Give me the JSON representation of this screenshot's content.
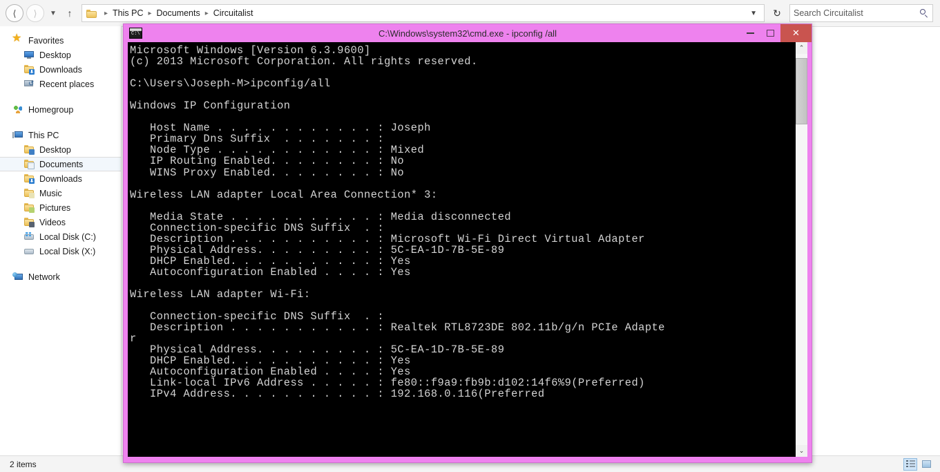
{
  "explorer": {
    "nav": {
      "back_icon": "arrow-left-icon",
      "forward_icon": "arrow-right-icon",
      "history_icon": "chevron-down-icon",
      "up_icon": "arrow-up-icon"
    },
    "breadcrumb": {
      "folder_icon": "folder-icon",
      "items": [
        "This PC",
        "Documents",
        "Circuitalist"
      ],
      "separator": "▸",
      "dropdown_icon": "chevron-down-icon",
      "refresh_icon": "refresh-icon",
      "refresh_glyph": "↻"
    },
    "search": {
      "placeholder": "Search Circuitalist",
      "value": "",
      "icon": "search-icon"
    },
    "sidebar": {
      "groups": [
        {
          "header": {
            "label": "Favorites",
            "icon": "star-icon"
          },
          "items": [
            {
              "label": "Desktop",
              "icon": "monitor-icon"
            },
            {
              "label": "Downloads",
              "icon": "folder-download-icon"
            },
            {
              "label": "Recent places",
              "icon": "recent-places-icon"
            }
          ]
        },
        {
          "header": {
            "label": "Homegroup",
            "icon": "homegroup-icon"
          },
          "items": []
        },
        {
          "header": {
            "label": "This PC",
            "icon": "computer-icon"
          },
          "items": [
            {
              "label": "Desktop",
              "icon": "folder-desktop-icon"
            },
            {
              "label": "Documents",
              "icon": "folder-documents-icon",
              "selected": true
            },
            {
              "label": "Downloads",
              "icon": "folder-download-icon"
            },
            {
              "label": "Music",
              "icon": "folder-music-icon"
            },
            {
              "label": "Pictures",
              "icon": "folder-pictures-icon"
            },
            {
              "label": "Videos",
              "icon": "folder-videos-icon"
            },
            {
              "label": "Local Disk (C:)",
              "icon": "hard-disk-windows-icon"
            },
            {
              "label": "Local Disk (X:)",
              "icon": "hard-disk-icon"
            }
          ]
        },
        {
          "header": {
            "label": "Network",
            "icon": "network-icon"
          },
          "items": []
        }
      ]
    },
    "status": {
      "item_count": "2 items",
      "details_view_icon": "details-view-icon",
      "tiles_view_icon": "large-icons-view-icon"
    }
  },
  "cmd_window": {
    "title": "C:\\Windows\\system32\\cmd.exe - ipconfig /all",
    "app_icon": "console-icon",
    "border_color": "#ee82ee",
    "background_color": "#000000",
    "text_color": "#d4d4d4",
    "controls": {
      "minimize": "minimize-button",
      "maximize": "maximize-button",
      "close": "close-button",
      "close_glyph": "✕",
      "close_color": "#c9544f"
    },
    "scrollbar": {
      "up_glyph": "⌃",
      "down_glyph": "⌄",
      "thumb_top_pct": 1,
      "thumb_height_pct": 17
    },
    "console_lines": [
      "Microsoft Windows [Version 6.3.9600]",
      "(c) 2013 Microsoft Corporation. All rights reserved.",
      "",
      "C:\\Users\\Joseph-M>ipconfig/all",
      "",
      "Windows IP Configuration",
      "",
      "   Host Name . . . . . . . . . . . . : Joseph",
      "   Primary Dns Suffix  . . . . . . . :",
      "   Node Type . . . . . . . . . . . . : Mixed",
      "   IP Routing Enabled. . . . . . . . : No",
      "   WINS Proxy Enabled. . . . . . . . : No",
      "",
      "Wireless LAN adapter Local Area Connection* 3:",
      "",
      "   Media State . . . . . . . . . . . : Media disconnected",
      "   Connection-specific DNS Suffix  . :",
      "   Description . . . . . . . . . . . : Microsoft Wi-Fi Direct Virtual Adapter",
      "   Physical Address. . . . . . . . . : 5C-EA-1D-7B-5E-89",
      "   DHCP Enabled. . . . . . . . . . . : Yes",
      "   Autoconfiguration Enabled . . . . : Yes",
      "",
      "Wireless LAN adapter Wi-Fi:",
      "",
      "   Connection-specific DNS Suffix  . :",
      "   Description . . . . . . . . . . . : Realtek RTL8723DE 802.11b/g/n PCIe Adapte",
      "r",
      "   Physical Address. . . . . . . . . : 5C-EA-1D-7B-5E-89",
      "   DHCP Enabled. . . . . . . . . . . : Yes",
      "   Autoconfiguration Enabled . . . . : Yes",
      "   Link-local IPv6 Address . . . . . : fe80::f9a9:fb9b:d102:14f6%9(Preferred)",
      "   IPv4 Address. . . . . . . . . . . : 192.168.0.116(Preferred"
    ]
  }
}
